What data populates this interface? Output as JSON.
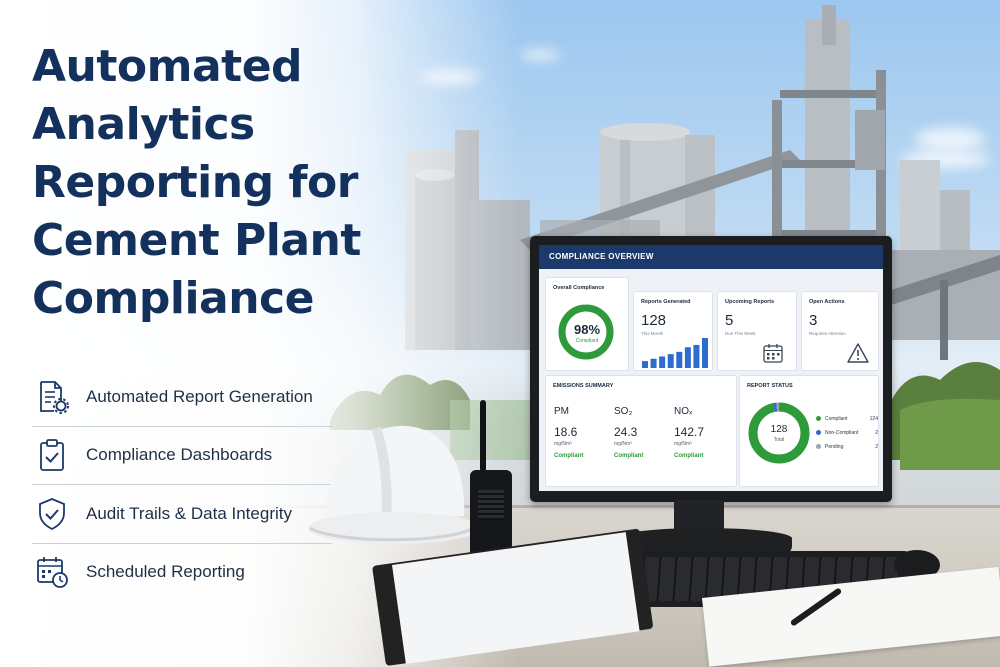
{
  "headline": "Automated Analytics Reporting for Cement Plant Compliance",
  "features": [
    {
      "label": "Automated Report Generation",
      "icon": "report-gear-icon"
    },
    {
      "label": "Compliance Dashboards",
      "icon": "clipboard-check-icon"
    },
    {
      "label": "Audit Trails & Data Integrity",
      "icon": "shield-check-icon"
    },
    {
      "label": "Scheduled Reporting",
      "icon": "calendar-clock-icon"
    }
  ],
  "dashboard": {
    "title": "COMPLIANCE OVERVIEW",
    "overall": {
      "label": "Overall Compliance",
      "value": "98%",
      "status": "Compliant",
      "percent": 98
    },
    "reports_generated": {
      "label": "Reports Generated",
      "value": "128",
      "sub": "This Month",
      "bars": [
        3,
        4,
        5,
        6,
        7,
        9,
        10,
        13
      ]
    },
    "upcoming": {
      "label": "Upcoming Reports",
      "value": "5",
      "sub": "Due This Week"
    },
    "open_actions": {
      "label": "Open Actions",
      "value": "3",
      "sub": "Requires Attention"
    },
    "emissions": {
      "title": "EMISSIONS SUMMARY",
      "items": [
        {
          "name": "PM",
          "value": "18.6",
          "unit": "mg/Nm³",
          "status": "Compliant"
        },
        {
          "name": "SO₂",
          "value": "24.3",
          "unit": "mg/Nm³",
          "status": "Compliant"
        },
        {
          "name": "NOₓ",
          "value": "142.7",
          "unit": "mg/Nm³",
          "status": "Compliant"
        }
      ]
    },
    "report_status": {
      "title": "REPORT STATUS",
      "total": "128",
      "total_label": "Total",
      "rows": [
        {
          "label": "Compliant",
          "count": "124",
          "color": "#2f9a3a"
        },
        {
          "label": "Non-Compliant",
          "count": "2",
          "color": "#2e6bd0"
        },
        {
          "label": "Pending",
          "count": "2",
          "color": "#9aa4ae"
        }
      ]
    }
  },
  "colors": {
    "navy": "#13315c",
    "accent": "#1b3a6b",
    "green": "#2f9a3a",
    "blue": "#2e6bd0"
  }
}
